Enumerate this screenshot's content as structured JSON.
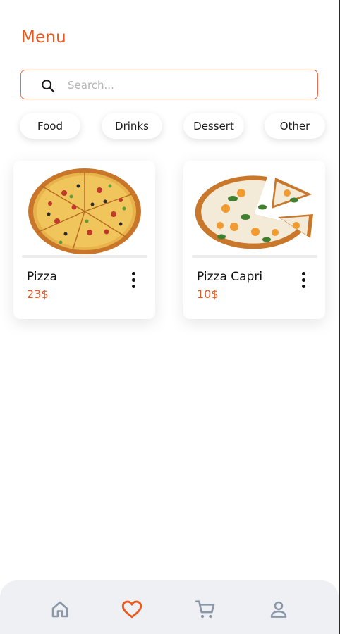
{
  "app": {
    "title": "Menu"
  },
  "search": {
    "placeholder": "Search...",
    "value": ""
  },
  "categories": [
    {
      "label": "Food"
    },
    {
      "label": "Drinks"
    },
    {
      "label": "Dessert"
    },
    {
      "label": "Other"
    }
  ],
  "products": [
    {
      "name": "Pizza",
      "price": "23$",
      "image": "pizza-photo"
    },
    {
      "name": "Pizza Capri",
      "price": "10$",
      "image": "pizza-capri-photo"
    }
  ],
  "bottom_nav": [
    {
      "icon": "home-icon",
      "active": false
    },
    {
      "icon": "heart-icon",
      "active": true
    },
    {
      "icon": "cart-icon",
      "active": false
    },
    {
      "icon": "profile-icon",
      "active": false
    }
  ],
  "colors": {
    "accent": "#ea5a1f",
    "search_border": "#ef6a47",
    "nav_inactive": "#8a97a8",
    "nav_bar": "#eef0f3"
  }
}
